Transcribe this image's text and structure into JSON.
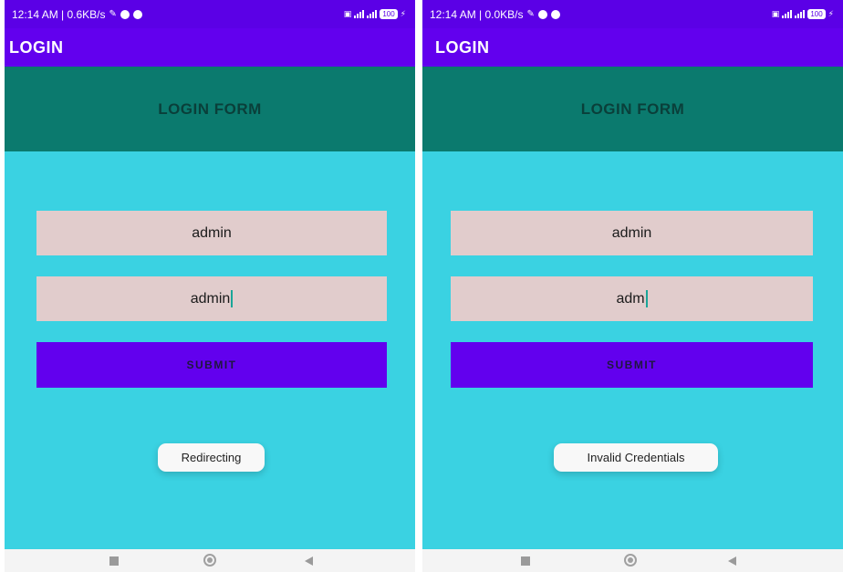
{
  "screens": [
    {
      "status": {
        "time_net": "12:14 AM | 0.6KB/s",
        "battery": "100"
      },
      "app_bar_title": "LOGIN",
      "form_header": "LOGIN FORM",
      "username_value": "admin",
      "password_value": "admin",
      "submit_label": "SUBMIT",
      "toast": "Redirecting"
    },
    {
      "status": {
        "time_net": "12:14 AM | 0.0KB/s",
        "battery": "100"
      },
      "app_bar_title": "LOGIN",
      "form_header": "LOGIN FORM",
      "username_value": "admin",
      "password_value": "adm",
      "submit_label": "SUBMIT",
      "toast": "Invalid Credentials"
    }
  ],
  "colors": {
    "status_bar": "#5b00e6",
    "app_bar": "#6200ee",
    "form_header": "#0b7a6e",
    "content_bg": "#3ad2e2",
    "field_bg": "#e1cccc",
    "submit_bg": "#6200ee"
  },
  "icons": [
    "bluetooth-icon",
    "alarm-icon",
    "wifi-signal-icon",
    "battery-icon",
    "nav-recents-icon",
    "nav-home-icon",
    "nav-back-icon"
  ]
}
